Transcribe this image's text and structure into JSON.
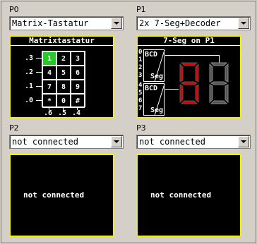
{
  "ports": [
    {
      "label": "P0",
      "selected": "Matrix-Tastatur"
    },
    {
      "label": "P1",
      "selected": "2x 7-Seg+Decoder"
    },
    {
      "label": "P2",
      "selected": "not connected"
    },
    {
      "label": "P3",
      "selected": "not connected"
    }
  ],
  "keypad": {
    "title": "Matrixtastatur",
    "row_labels": [
      ".3",
      ".2",
      ".1",
      ".0"
    ],
    "col_labels": [
      ".6",
      ".5",
      ".4"
    ],
    "keys": [
      [
        "1",
        "2",
        "3"
      ],
      [
        "4",
        "5",
        "6"
      ],
      [
        "7",
        "8",
        "9"
      ],
      [
        "*",
        "0",
        "#"
      ]
    ],
    "pressed_key": "1",
    "pressed_color": "#22cc22"
  },
  "sevenseg": {
    "title": "7-Seg on P1",
    "bits_upper": [
      "0",
      "1",
      "2",
      "3"
    ],
    "bits_lower": [
      "4",
      "5",
      "6",
      "7"
    ],
    "decoder_label_top": "BCD",
    "decoder_label_bottom": "Seg",
    "lit_color": "#e00000",
    "unlit_color": "#555555"
  },
  "nc_panels": [
    {
      "text": "not connected"
    },
    {
      "text": "not connected"
    }
  ],
  "colors": {
    "panel_border": "#f0f000",
    "panel_bg": "#000000",
    "window_bg": "#d4d0c8"
  }
}
